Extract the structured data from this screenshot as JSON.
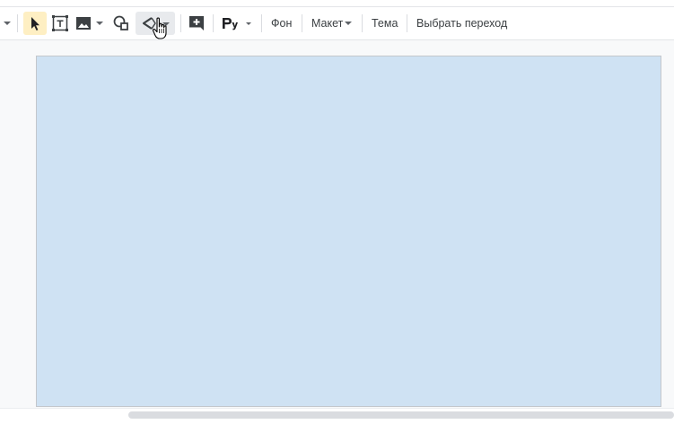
{
  "toolbar": {
    "background_label": "Фон",
    "layout_label": "Макет",
    "theme_label": "Тема",
    "transition_label": "Выбрать переход"
  },
  "icons": {
    "select": "cursor-arrow-icon",
    "textbox": "text-box-icon",
    "image": "image-icon",
    "shape": "shape-icon",
    "line": "line-icon",
    "comment": "add-comment-icon",
    "format": "format-options-icon"
  },
  "colors": {
    "slide_background": "#cfe2f3",
    "selected_tool_highlight": "#feefc3"
  }
}
